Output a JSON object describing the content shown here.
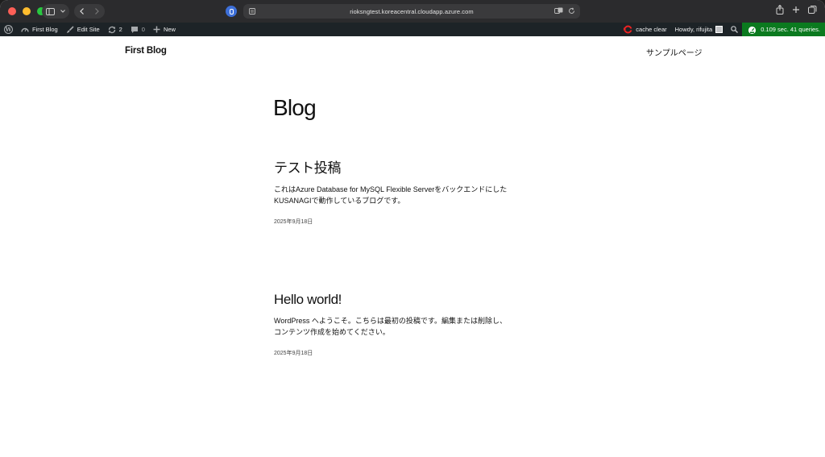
{
  "browser": {
    "url": "rioksngtest.koreacentral.cloudapp.azure.com"
  },
  "adminbar": {
    "site_name": "First Blog",
    "edit_site": "Edit Site",
    "updates_count": "2",
    "comments_count": "0",
    "new_label": "New",
    "cache_clear": "cache clear",
    "howdy": "Howdy, rifujita",
    "perf": "0.109 sec. 41 queries."
  },
  "site": {
    "title": "First Blog",
    "nav_item": "サンプルページ"
  },
  "page": {
    "heading": "Blog"
  },
  "posts": [
    {
      "title": "テスト投稿",
      "excerpt_line1": "これはAzure Database for MySQL Flexible Serverをバックエンドにした",
      "excerpt_line2": "KUSANAGIで動作しているブログです。",
      "date": "2025年9月18日"
    },
    {
      "title": "Hello world!",
      "excerpt_line1": "WordPress へようこそ。こちらは最初の投稿です。編集または削除し、",
      "excerpt_line2": "コンテンツ作成を始めてください。",
      "date": "2025年9月18日"
    }
  ],
  "colors": {
    "adminbar_bg": "#1d2327",
    "perf_bg": "#0b7a1f",
    "toolbar_bg": "#2b2b2d"
  }
}
